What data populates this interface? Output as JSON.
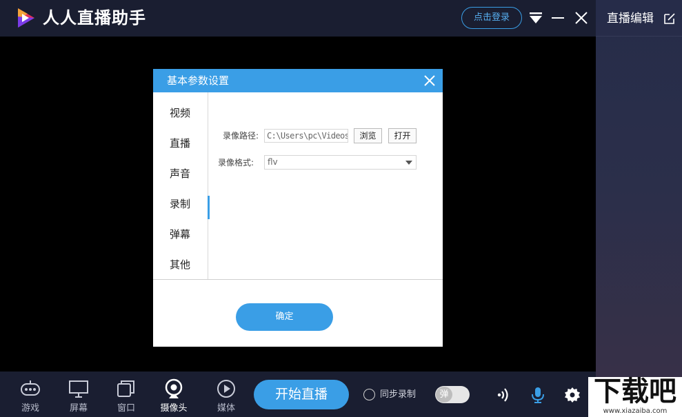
{
  "app": {
    "title": "人人直播助手",
    "login_label": "点击登录"
  },
  "right_panel": {
    "title": "直播编辑"
  },
  "dialog": {
    "title": "基本参数设置",
    "sidebar": [
      {
        "label": "视频"
      },
      {
        "label": "直播"
      },
      {
        "label": "声音"
      },
      {
        "label": "录制",
        "active": true
      },
      {
        "label": "弹幕"
      },
      {
        "label": "其他"
      }
    ],
    "record_path_label": "录像路径:",
    "record_path_value": "C:\\Users\\pc\\Videos",
    "browse_label": "浏览",
    "open_label": "打开",
    "record_format_label": "录像格式:",
    "record_format_value": "flv",
    "ok_label": "确定"
  },
  "toolbar": {
    "tools": [
      {
        "label": "游戏",
        "icon": "gamepad-icon"
      },
      {
        "label": "屏幕",
        "icon": "monitor-icon"
      },
      {
        "label": "窗口",
        "icon": "window-icon"
      },
      {
        "label": "摄像头",
        "icon": "camera-icon"
      },
      {
        "label": "媒体",
        "icon": "media-play-icon"
      }
    ],
    "start_label": "开始直播",
    "sync_record_label": "同步录制",
    "danmaku_toggle_label": "弹"
  },
  "watermark": {
    "text": "下载吧",
    "url": "www.xiazaiba.com"
  },
  "colors": {
    "accent": "#3a9ee6",
    "titlebar": "#1a1e31",
    "preview": "#000000"
  }
}
